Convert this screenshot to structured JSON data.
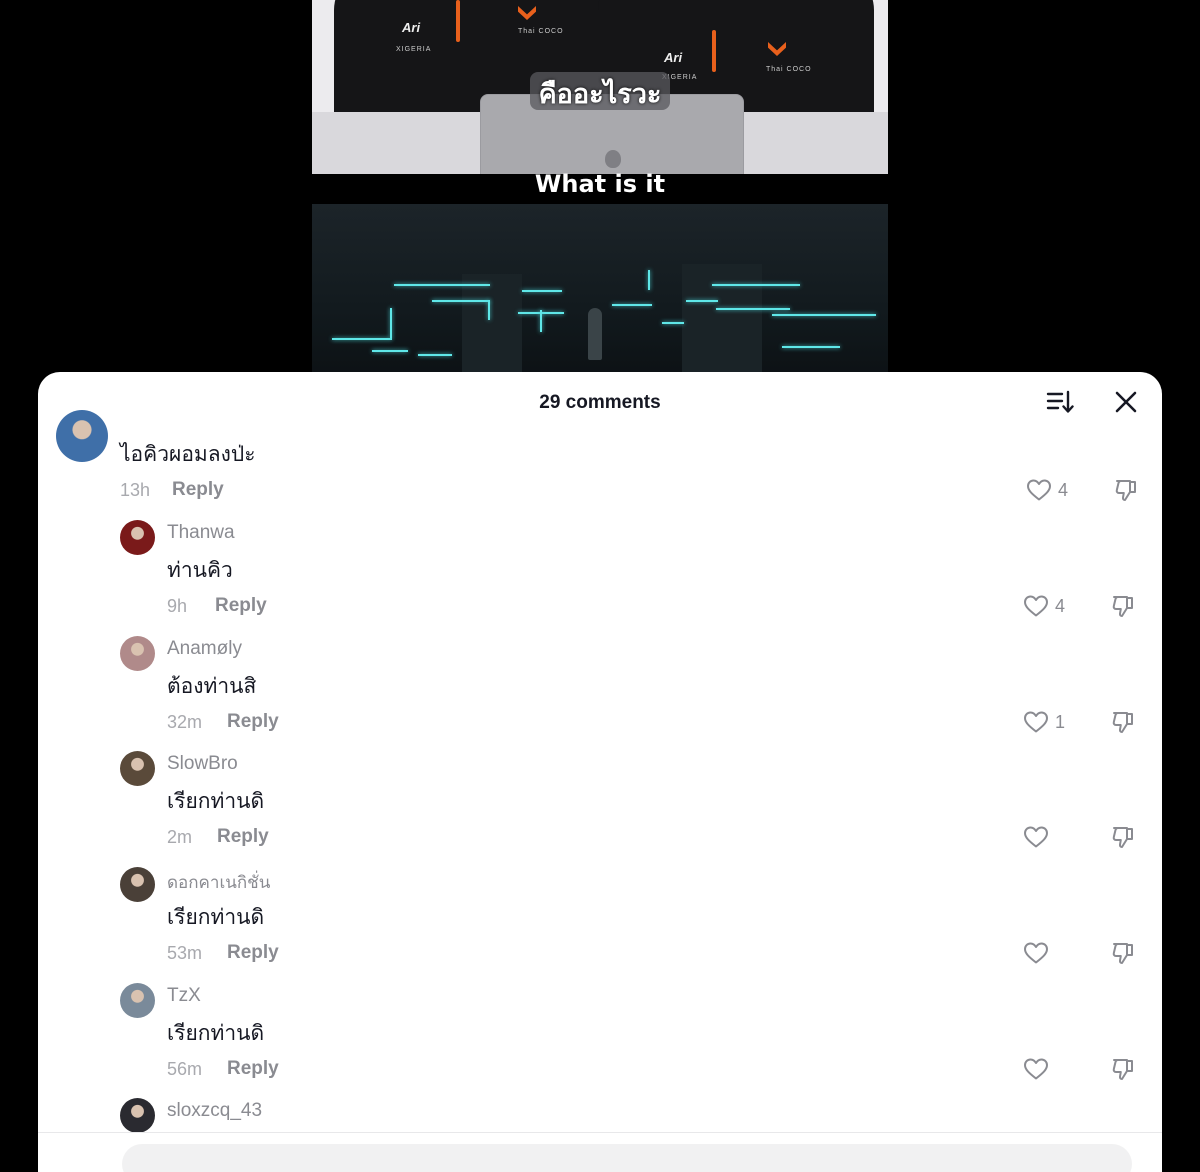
{
  "video": {
    "caption_th": "คืออะไรวะ",
    "caption_en": "What is it",
    "shirt_brand": "Ari",
    "shirt_sponsor": "XIGERIA",
    "shirt_logo_text": "Thai COCO"
  },
  "sheet": {
    "title": "29 comments",
    "sort_icon": "sort-icon",
    "close_icon": "close-icon"
  },
  "comments": [
    {
      "username": "",
      "text": "ไอคิวผอมลงป่ะ",
      "time": "13h",
      "reply": "Reply",
      "likes": "4",
      "avatar_color": "#3f6fa8"
    },
    {
      "username": "Thanwa",
      "text": "ท่านคิว",
      "time": "9h",
      "reply": "Reply",
      "likes": "4",
      "avatar_color": "#7a1a1a"
    },
    {
      "username": "Anamøly",
      "text": "ต้องท่านสิ",
      "time": "32m",
      "reply": "Reply",
      "likes": "1",
      "avatar_color": "#b08a8a"
    },
    {
      "username": "SlowBro",
      "text": "เรียกท่านดิ",
      "time": "2m",
      "reply": "Reply",
      "likes": "",
      "avatar_color": "#5a4a3a"
    },
    {
      "username": "ดอกคาเนกิชั่น",
      "text": "เรียกท่านดิ",
      "time": "53m",
      "reply": "Reply",
      "likes": "",
      "avatar_color": "#4a4038"
    },
    {
      "username": "TzX",
      "text": "เรียกท่านดิ",
      "time": "56m",
      "reply": "Reply",
      "likes": "",
      "avatar_color": "#7a8a9a"
    },
    {
      "username": "sloxzcq_43",
      "text": "",
      "time": "",
      "reply": "",
      "likes": "",
      "avatar_color": "#2a2a30"
    }
  ],
  "icons": {
    "like": "heart-icon",
    "dislike": "thumbs-down-icon"
  }
}
